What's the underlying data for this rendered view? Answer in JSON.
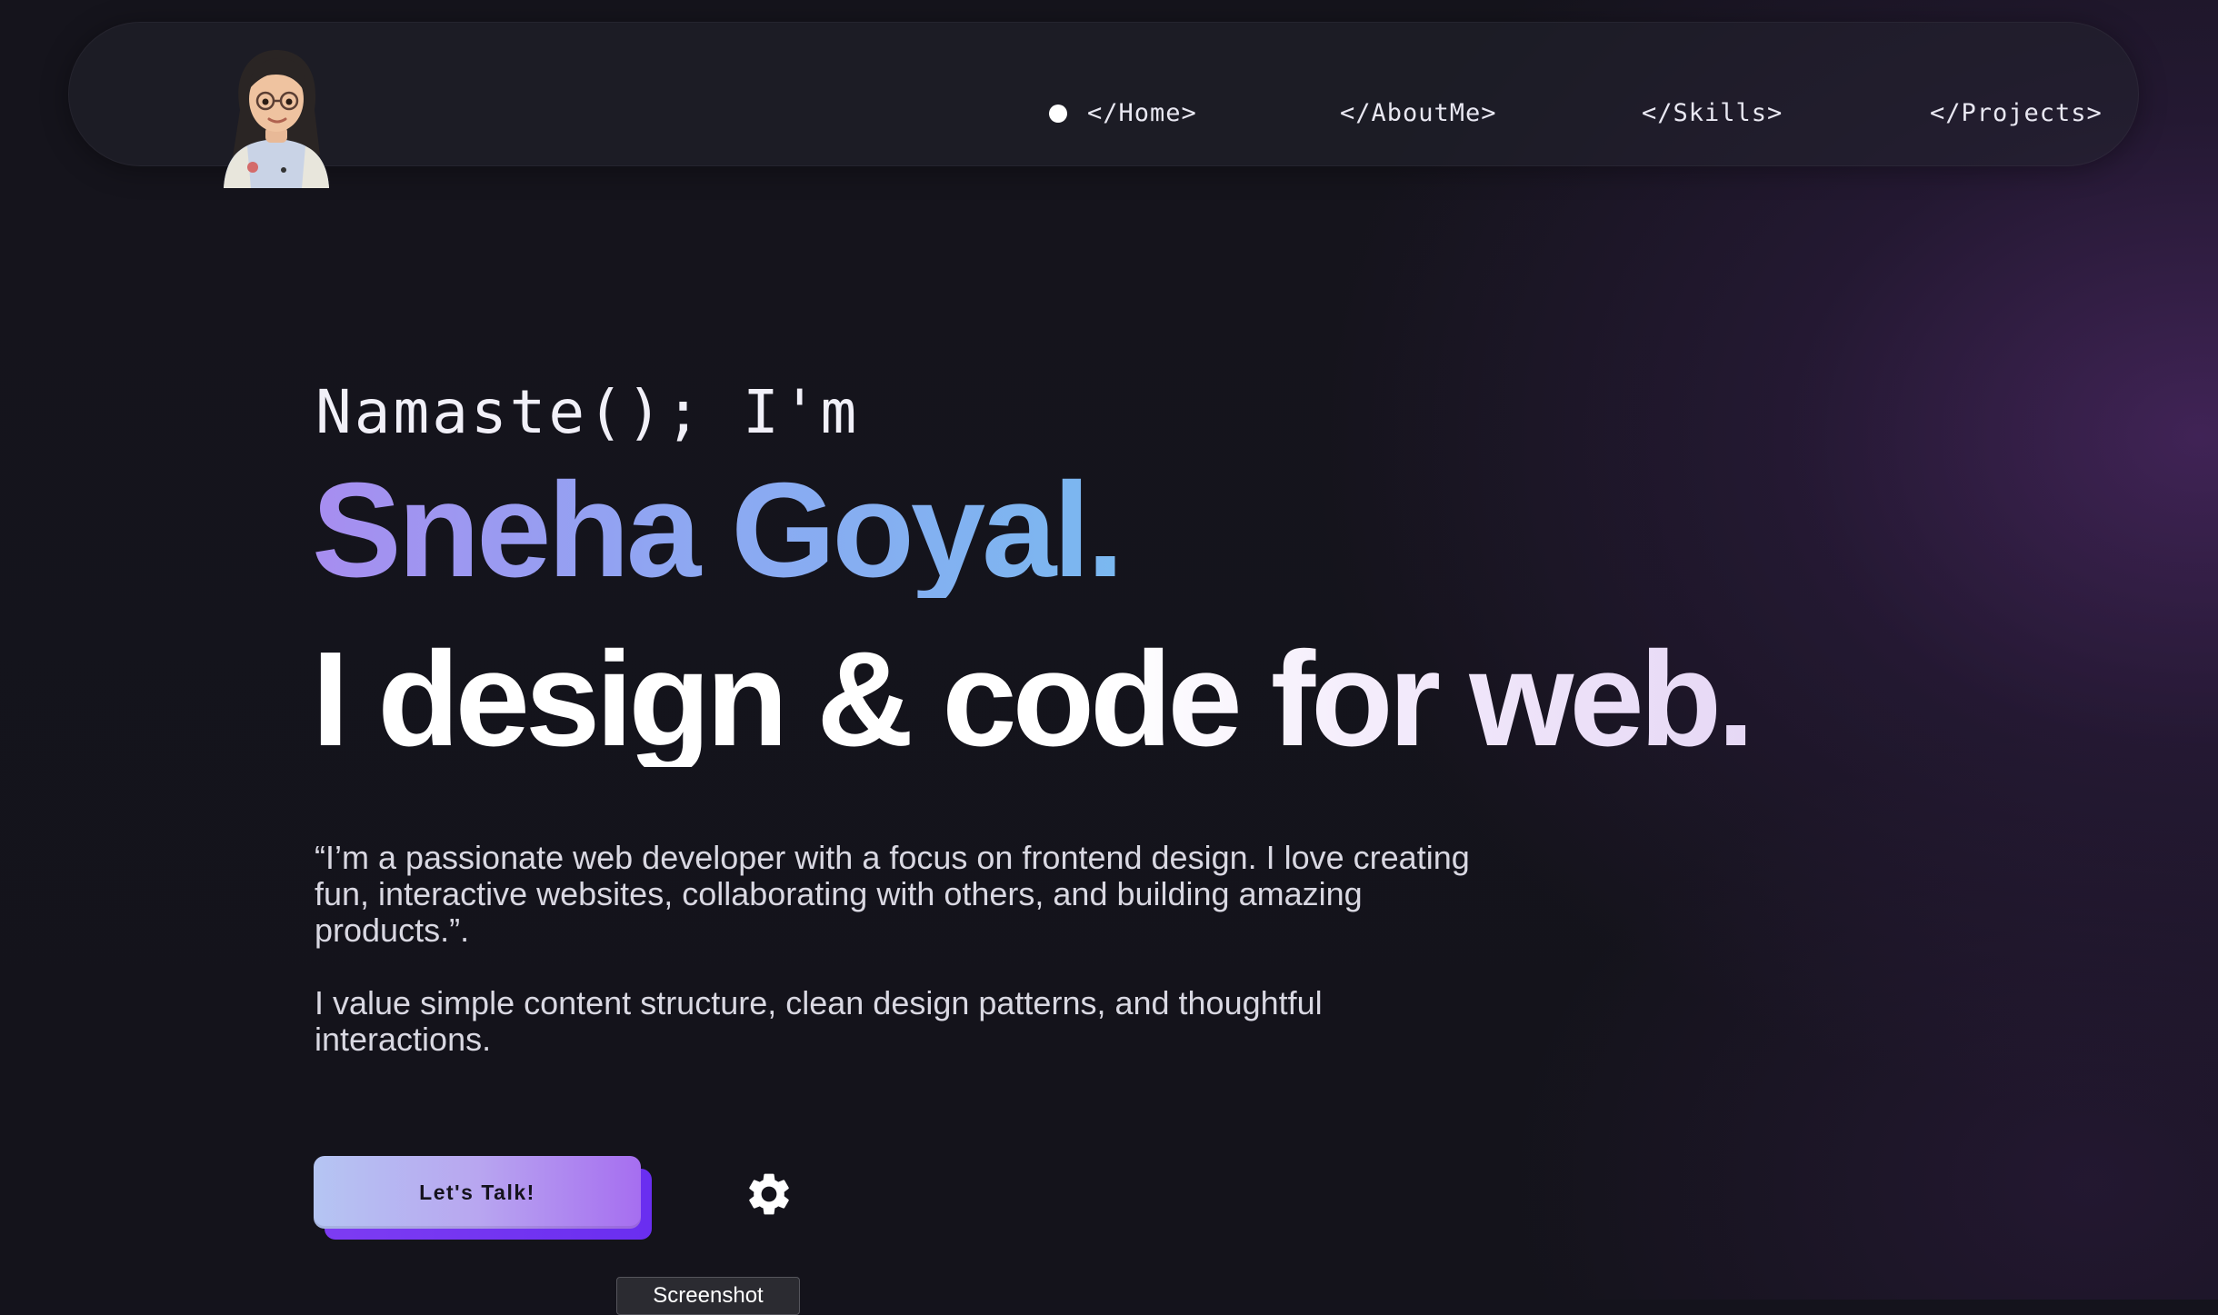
{
  "nav": {
    "items": [
      {
        "label": "</Home>",
        "active": true
      },
      {
        "label": "</AboutMe>",
        "active": false
      },
      {
        "label": "</Skills>",
        "active": false
      },
      {
        "label": "</Projects>",
        "active": false
      }
    ]
  },
  "hero": {
    "greeting": "Namaste(); I'm",
    "name": "Sneha Goyal.",
    "tagline": "I design & code for web.",
    "paragraph1": "“I’m a passionate web developer with a focus on frontend design. I love creating fun, interactive websites, collaborating with others, and building amazing products.”.",
    "paragraph2": "I value simple content structure, clean design patterns, and thoughtful interactions.",
    "cta_label": "Let's Talk!"
  },
  "tooltip": {
    "text": "Screenshot"
  },
  "icons": {
    "avatar": "avatar-memoji",
    "settings": "gear-icon"
  },
  "colors": {
    "background": "#14131c",
    "accent_purple": "#7d3cf2",
    "name_gradient_start": "#a78df0",
    "name_gradient_end": "#7ab8f0"
  }
}
